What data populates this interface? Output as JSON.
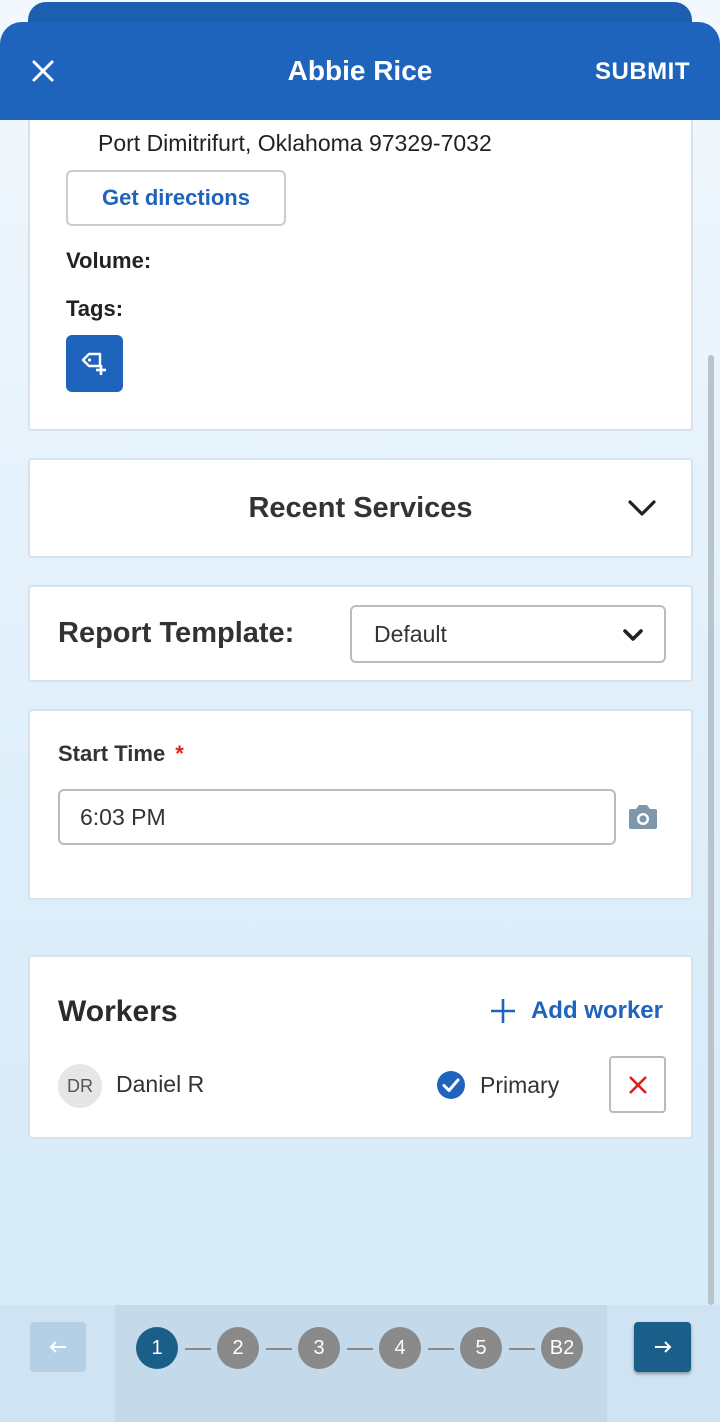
{
  "header": {
    "title": "Abbie Rice",
    "submit_label": "SUBMIT",
    "close_icon": "close-icon"
  },
  "address": {
    "line": "Port Dimitrifurt, Oklahoma 97329-7032",
    "directions_label": "Get directions",
    "volume_label": "Volume:",
    "tags_label": "Tags:",
    "add_tag_icon": "add-tag-icon"
  },
  "recent_services": {
    "title": "Recent Services"
  },
  "report_template": {
    "label": "Report Template:",
    "selected": "Default"
  },
  "start_time": {
    "label": "Start Time",
    "required_mark": "*",
    "value": "6:03 PM"
  },
  "workers": {
    "title": "Workers",
    "add_label": "Add worker",
    "items": [
      {
        "initials": "DR",
        "name": "Daniel R",
        "role": "Primary"
      }
    ]
  },
  "pagination": {
    "steps": [
      "1",
      "2",
      "3",
      "4",
      "5",
      "B2"
    ],
    "active_index": 0
  },
  "colors": {
    "primary": "#1f64bc",
    "nav_dark": "#1a5e8a",
    "required": "#e02020"
  }
}
